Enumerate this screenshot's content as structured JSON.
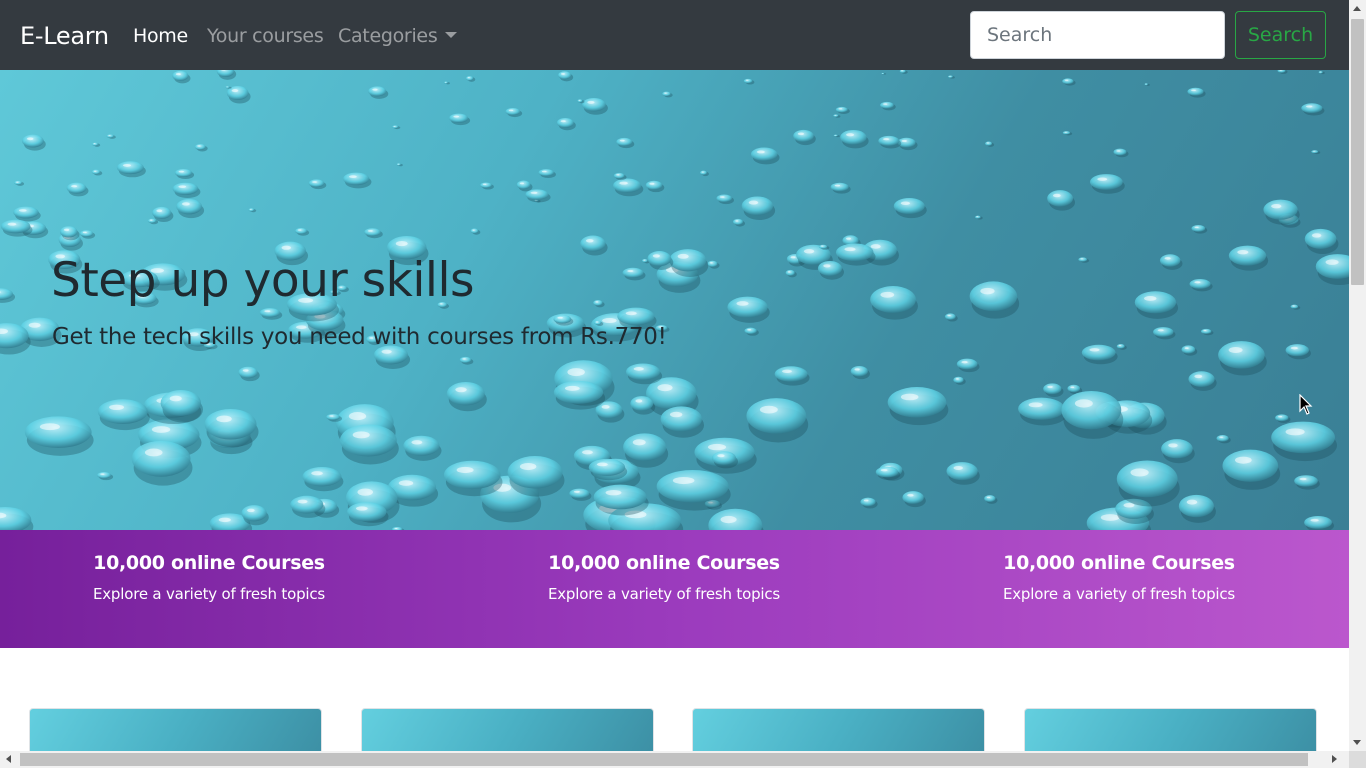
{
  "navbar": {
    "brand": "E-Learn",
    "links": [
      {
        "label": "Home",
        "active": true
      },
      {
        "label": "Your courses",
        "active": false
      },
      {
        "label": "Categories",
        "active": false
      }
    ],
    "search_placeholder": "Search",
    "search_button": "Search"
  },
  "hero": {
    "title": "Step up your skills",
    "subtitle": "Get the tech skills you need with courses from Rs.770!"
  },
  "stats": [
    {
      "title": "10,000 online Courses",
      "description": "Explore a variety of fresh topics"
    },
    {
      "title": "10,000 online Courses",
      "description": "Explore a variety of fresh topics"
    },
    {
      "title": "10,000 online Courses",
      "description": "Explore a variety of fresh topics"
    }
  ],
  "colors": {
    "navbar_bg": "#343a40",
    "search_button": "#28a745",
    "stats_gradient_start": "#76209b",
    "stats_gradient_end": "#bb57cd"
  }
}
